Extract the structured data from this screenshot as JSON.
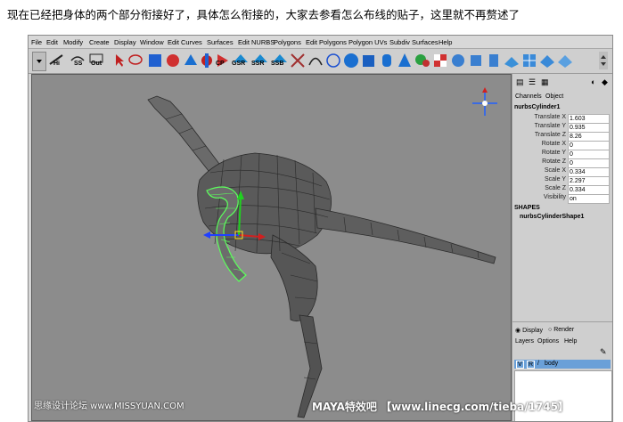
{
  "caption": "现在已经把身体的两个部分衔接好了，具体怎么衔接的，大家去参看怎么布线的贴子，这里就不再赘述了",
  "menu": [
    "File",
    "Edit",
    "Modify",
    "Create",
    "Display",
    "Window",
    "Edit Curves",
    "Surfaces",
    "Edit NURBS",
    "Polygons",
    "Edit Polygons",
    "Polygon UVs",
    "Subdiv Surfaces",
    "Help"
  ],
  "shelf_labels": {
    "hi": "Hi",
    "ss": "SS",
    "out": "Out",
    "cp": "CP",
    "gsr": "GSR",
    "ssr": "SSR",
    "ssb": "SSB"
  },
  "channel_box": {
    "tab_channels": "Channels",
    "tab_object": "Object",
    "object_name": "nurbsCylinder1",
    "attributes": [
      {
        "name": "Translate X",
        "value": "1.603"
      },
      {
        "name": "Translate Y",
        "value": "0.935"
      },
      {
        "name": "Translate Z",
        "value": "8.26"
      },
      {
        "name": "Rotate X",
        "value": "0"
      },
      {
        "name": "Rotate Y",
        "value": "0"
      },
      {
        "name": "Rotate Z",
        "value": "0"
      },
      {
        "name": "Scale X",
        "value": "0.334"
      },
      {
        "name": "Scale Y",
        "value": "2.297"
      },
      {
        "name": "Scale Z",
        "value": "0.334"
      },
      {
        "name": "Visibility",
        "value": "on"
      }
    ],
    "shapes_header": "SHAPES",
    "shape_name": "nurbsCylinderShape1"
  },
  "layer_editor": {
    "radio_display": "Display",
    "radio_render": "Render",
    "menu_layers": "Layers",
    "menu_options": "Options",
    "menu_help": "Help",
    "layer_v": "V",
    "layer_r": "R",
    "layer_name": "body"
  },
  "watermark_left": "思缘设计论坛 www.MISSYUAN.COM",
  "watermark_right": "MAYA特效吧 【www.linecg.com/tieba/1745】",
  "colors": {
    "viewport_bg": "#8c8c8c",
    "mesh": "#4a4a4a",
    "selection": "#5cff5c",
    "layer_row": "#6aa0d8"
  }
}
